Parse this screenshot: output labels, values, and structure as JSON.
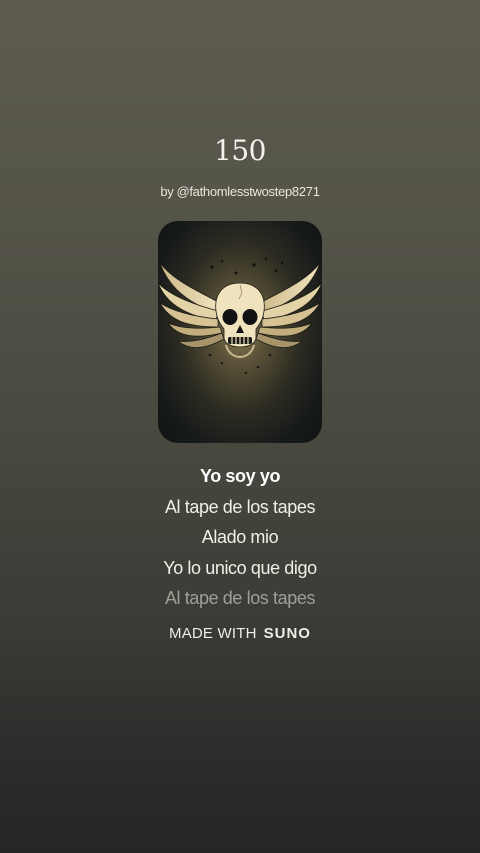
{
  "song": {
    "title": "150",
    "by_prefix": "by",
    "artist": "@fathomlesstwostep8271"
  },
  "cover": {
    "icon": "winged-skull-icon",
    "accent": "#e8d9a8"
  },
  "lyrics": [
    {
      "text": "Yo soy yo",
      "state": "active"
    },
    {
      "text": "Al tape de los tapes",
      "state": "normal"
    },
    {
      "text": "Alado mio",
      "state": "normal"
    },
    {
      "text": "Yo lo unico que digo",
      "state": "normal"
    },
    {
      "text": "Al tape de los tapes",
      "state": "faded"
    }
  ],
  "brand": {
    "made_with": "MADE WITH",
    "name": "SUNO"
  },
  "colors": {
    "background_top": "#5d5b4f",
    "background_bottom": "#232527",
    "text": "#f3f1ea"
  }
}
